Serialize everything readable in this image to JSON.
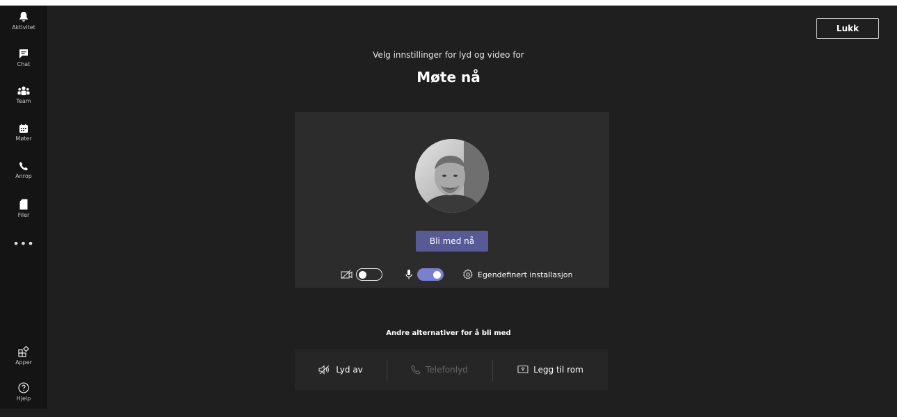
{
  "rail": {
    "items": [
      {
        "label": "Aktivitet",
        "icon": "bell-icon"
      },
      {
        "label": "Chat",
        "icon": "chat-icon"
      },
      {
        "label": "Team",
        "icon": "team-icon"
      },
      {
        "label": "Møter",
        "icon": "calendar-icon"
      },
      {
        "label": "Anrop",
        "icon": "phone-icon"
      },
      {
        "label": "Filer",
        "icon": "file-icon"
      }
    ],
    "more": "•••",
    "bottom": [
      {
        "label": "Apper",
        "icon": "apps-icon"
      },
      {
        "label": "Hjelp",
        "icon": "help-icon"
      }
    ]
  },
  "header": {
    "close_label": "Lukk",
    "subtitle": "Velg innstillinger for lyd og video for",
    "meeting_title": "Møte nå"
  },
  "prejoin": {
    "join_label": "Bli med nå",
    "camera_on": false,
    "mic_on": true,
    "custom_setup_label": "Egendefinert installasjon"
  },
  "alternatives": {
    "title": "Andre alternativer for å bli med",
    "options": [
      {
        "label": "Lyd av",
        "icon": "speaker-off-icon",
        "enabled": true
      },
      {
        "label": "Telefonlyd",
        "icon": "phone-icon",
        "enabled": false
      },
      {
        "label": "Legg til rom",
        "icon": "cast-icon",
        "enabled": true
      }
    ]
  },
  "colors": {
    "background": "#1f1f1f",
    "rail": "#141414",
    "panel": "#2d2c2c",
    "accent": "#585a96",
    "toggle_on": "#7b7fd0"
  }
}
